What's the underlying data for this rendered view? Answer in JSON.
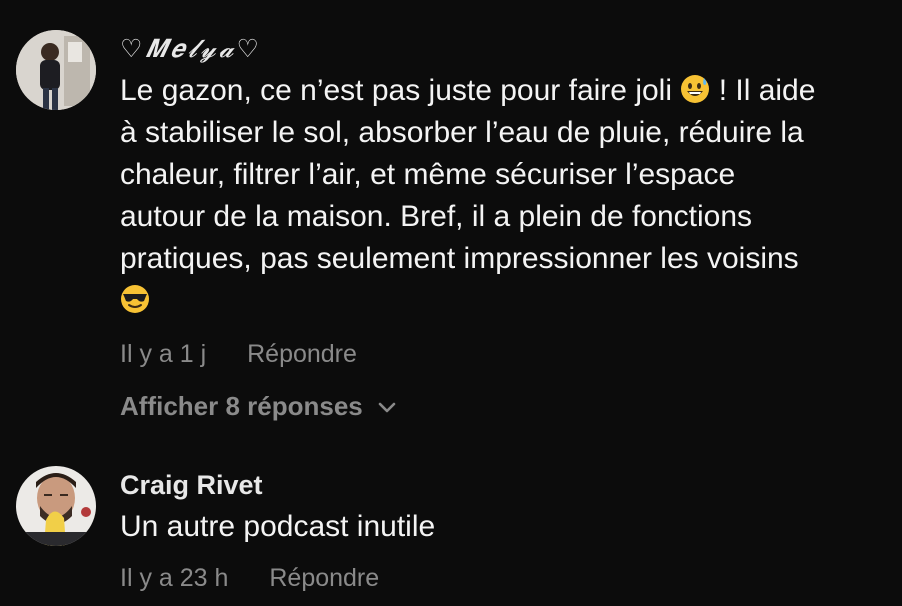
{
  "comments": [
    {
      "username": "♡𝑴𝒆𝓵𝔂𝓪♡",
      "text_lines": [
        "Le gazon, ce n’est pas juste pour faire joli",
        "! Il aide",
        "à stabiliser le sol, absorber l’eau de pluie, réduire la",
        "chaleur, filtrer l’air, et même sécuriser l’espace",
        "autour de la maison. Bref, il a plein de fonctions",
        "pratiques, pas seulement impressionner les voisins"
      ],
      "emoji_1": "grinning-sweat-emoji",
      "emoji_2": "sunglasses-emoji",
      "time": "Il y a 1 j",
      "reply_label": "Répondre",
      "show_replies": "Afficher 8 réponses"
    },
    {
      "username": "Craig Rivet",
      "text": "Un autre podcast inutile",
      "time": "Il y a 23 h",
      "reply_label": "Répondre"
    }
  ],
  "colors": {
    "background": "#0c0c0c",
    "text": "#f4f4f4",
    "muted": "#8a8a8a",
    "emoji_yellow": "#f7c234"
  }
}
